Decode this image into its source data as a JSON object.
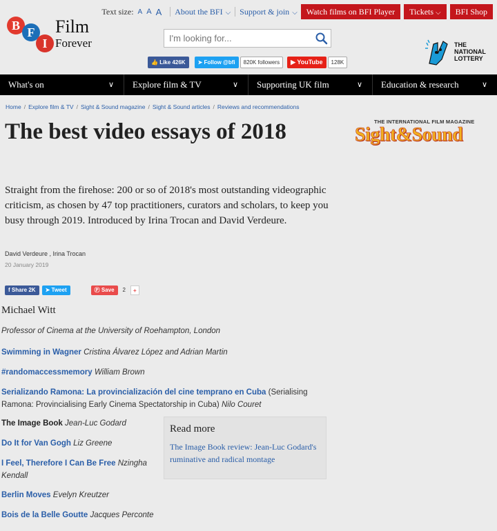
{
  "logo": {
    "letters": [
      "B",
      "F",
      "I"
    ],
    "line1": "Film",
    "line2": "Forever"
  },
  "topbar": {
    "text_size_label": "Text size:",
    "text_size_options": [
      "A",
      "A",
      "A"
    ],
    "about": "About the BFI",
    "support": "Support & join",
    "buttons": [
      "Watch films on BFI Player",
      "Tickets",
      "BFI Shop"
    ]
  },
  "search": {
    "placeholder": "I'm looking for..."
  },
  "social": {
    "fb_label": "Like",
    "fb_count": "426K",
    "tw_label": "Follow @bfi",
    "tw_count": "820K followers",
    "yt_label": "YouTube",
    "yt_count": "128K"
  },
  "lottery": {
    "line1": "THE",
    "line2": "NATIONAL",
    "line3": "LOTTERY"
  },
  "nav": [
    "What's on",
    "Explore film & TV",
    "Supporting UK film",
    "Education & research"
  ],
  "breadcrumb": [
    "Home",
    "Explore film & TV",
    "Sight & Sound magazine",
    "Sight & Sound articles",
    "Reviews and recommendations"
  ],
  "article": {
    "title": "The best video essays of 2018",
    "standfirst": "Straight from the firehose: 200 or so of 2018's most outstanding videographic criticism, as chosen by 47 top practitioners, curators and scholars, to keep you busy through 2019. Introduced by Irina Trocan and David Verdeure.",
    "byline": "David Verdeure , Irina Trocan",
    "date": "20 January 2019"
  },
  "share": {
    "fb_label": "Share",
    "fb_count": "2K",
    "tw_label": "Tweet",
    "pin_label": "Save",
    "pin_count": "2",
    "plus": "+"
  },
  "sight_sound": {
    "tagline": "THE INTERNATIONAL FILM MAGAZINE",
    "name": "Sight&Sound"
  },
  "body": {
    "author": "Michael Witt",
    "role": "Professor of Cinema at the University of Roehampton, London",
    "entries": [
      {
        "title": "Swimming in Wagner",
        "rest": "",
        "authors": "Cristina Álvarez López and Adrian Martin"
      },
      {
        "title": "#randomaccessmemory",
        "rest": "",
        "authors": "William Brown"
      },
      {
        "title": "Serializando Ramona: La provincialización del cine temprano en Cuba",
        "rest": " (Serialising Ramona: Provincialising Early Cinema Spectatorship in Cuba)",
        "authors": "Nilo Couret"
      },
      {
        "title": "The Image Book",
        "rest": "",
        "authors": "Jean-Luc Godard"
      },
      {
        "title": "Do It for Van Gogh",
        "rest": "",
        "authors": "Liz Greene"
      },
      {
        "title": "I Feel, Therefore I Can Be Free",
        "rest": "",
        "authors": "Nzingha Kendall"
      },
      {
        "title": "Berlin Moves",
        "rest": "",
        "authors": "Evelyn Kreutzer"
      },
      {
        "title": "Bois de la Belle Goutte",
        "rest": "",
        "authors": "Jacques Perconte"
      }
    ]
  },
  "read_more": {
    "heading": "Read more",
    "link": "The Image Book review: Jean-Luc Godard's ruminative and radical montage"
  },
  "colors": {
    "bfi_red": "#c4161c",
    "link_blue": "#2a5ea8",
    "nav_black": "#000000",
    "facebook": "#3b5998",
    "twitter": "#1da1f2",
    "youtube": "#e62117",
    "pinterest": "#e94b4b"
  }
}
